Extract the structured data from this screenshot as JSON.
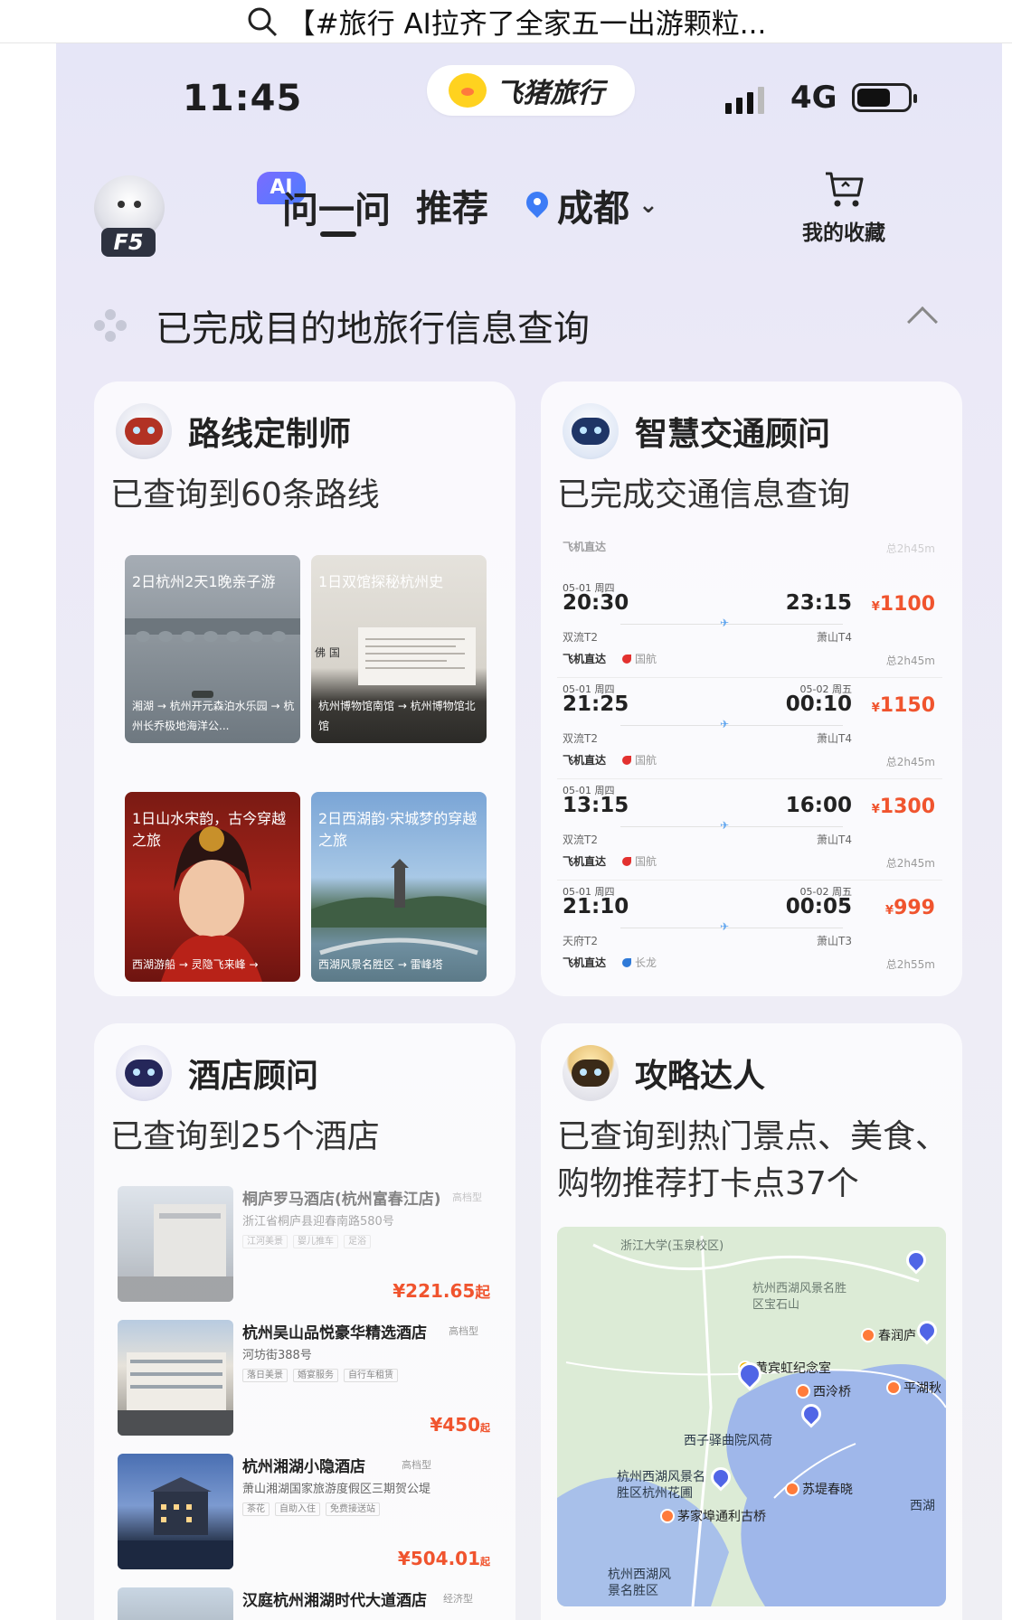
{
  "outer": {
    "title": "【#旅行 AI拉齐了全家五一出游颗粒..."
  },
  "status_bar": {
    "time": "11:45",
    "network": "4G",
    "brand": "飞猪旅行"
  },
  "nav": {
    "avatar_label": "F5",
    "ai_badge": "AI",
    "ask": "问一问",
    "recommend": "推荐",
    "city": "成都",
    "favorites": "我的收藏"
  },
  "summary": {
    "text": "已完成目的地旅行信息查询"
  },
  "route_card": {
    "title": "路线定制师",
    "subtitle": "已查询到60条路线",
    "tiles": [
      {
        "title": "2日杭州2天1晚亲子游",
        "path": "湘湖 → 杭州开元森泊水乐园 → 杭州长乔极地海洋公..."
      },
      {
        "title": "1日双馆探秘杭州史",
        "path": "杭州博物馆南馆 → 杭州博物馆北馆"
      },
      {
        "title": "1日山水宋韵，古今穿越之旅",
        "path": "西湖游船 → 灵隐飞来峰 →"
      },
      {
        "title": "2日西湖韵·宋城梦的穿越之旅",
        "path": "西湖风景名胜区 → 雷峰塔"
      }
    ]
  },
  "transport_card": {
    "title": "智慧交通顾问",
    "subtitle": "已完成交通信息查询",
    "top_hint": {
      "type": "飞机直达",
      "duration": "总2h45m"
    },
    "flights": [
      {
        "date": "05-01 周四",
        "dep": "20:30",
        "arr_date": "",
        "arr": "23:15",
        "price": "1100",
        "from": "双流T2",
        "to": "萧山T4",
        "type": "飞机直达",
        "airline": "国航",
        "duration": "总2h45m"
      },
      {
        "date": "05-01 周四",
        "dep": "21:25",
        "arr_date": "05-02 周五",
        "arr": "00:10",
        "price": "1150",
        "from": "双流T2",
        "to": "萧山T4",
        "type": "飞机直达",
        "airline": "国航",
        "duration": "总2h45m"
      },
      {
        "date": "05-01 周四",
        "dep": "13:15",
        "arr_date": "",
        "arr": "16:00",
        "price": "1300",
        "from": "双流T2",
        "to": "萧山T4",
        "type": "飞机直达",
        "airline": "国航",
        "duration": "总2h45m"
      },
      {
        "date": "05-01 周四",
        "dep": "21:10",
        "arr_date": "05-02 周五",
        "arr": "00:05",
        "price": "999",
        "from": "天府T2",
        "to": "萧山T3",
        "type": "飞机直达",
        "airline": "长龙",
        "duration": "总2h55m"
      }
    ]
  },
  "hotel_card": {
    "title": "酒店顾问",
    "subtitle": "已查询到25个酒店",
    "hotels": [
      {
        "name": "桐庐罗马酒店(杭州富春江店)",
        "tag": "高档型",
        "address": "浙江省桐庐县迎春南路580号",
        "features": [
          "江河美景",
          "婴儿推车",
          "足浴"
        ],
        "price": "¥221.65",
        "unit": "起"
      },
      {
        "name": "杭州吴山品悦豪华精选酒店",
        "tag": "高档型",
        "address": "河坊街388号",
        "features": [
          "落日美景",
          "婚宴服务",
          "自行车租赁"
        ],
        "price": "¥450",
        "unit": "起"
      },
      {
        "name": "杭州湘湖小隐酒店",
        "tag": "高档型",
        "address": "萧山湘湖国家旅游度假区三期贺公堤",
        "features": [
          "茶花",
          "自助入住",
          "免费接送站"
        ],
        "price": "¥504.01",
        "unit": "起"
      },
      {
        "name": "汉庭杭州湘湖时代大道酒店",
        "tag": "经济型",
        "address": "",
        "features": [],
        "price": "",
        "unit": ""
      }
    ]
  },
  "guide_card": {
    "title": "攻略达人",
    "subtitle_line1": "已查询到热门景点、美食、",
    "subtitle_line2": "购物推荐打卡点37个",
    "map": {
      "labels": [
        "浙江大学(玉泉校区)",
        "杭州西湖风景名胜区宝石山",
        "西子驿曲院风荷",
        "杭州西湖风景名胜区杭州花圃",
        "西湖",
        "杭州西湖风景名胜区"
      ],
      "pois": [
        "春润庐",
        "黄宾虹纪念室",
        "西泠桥",
        "平湖秋",
        "苏堤春晓",
        "茅家埠通利古桥"
      ]
    }
  }
}
